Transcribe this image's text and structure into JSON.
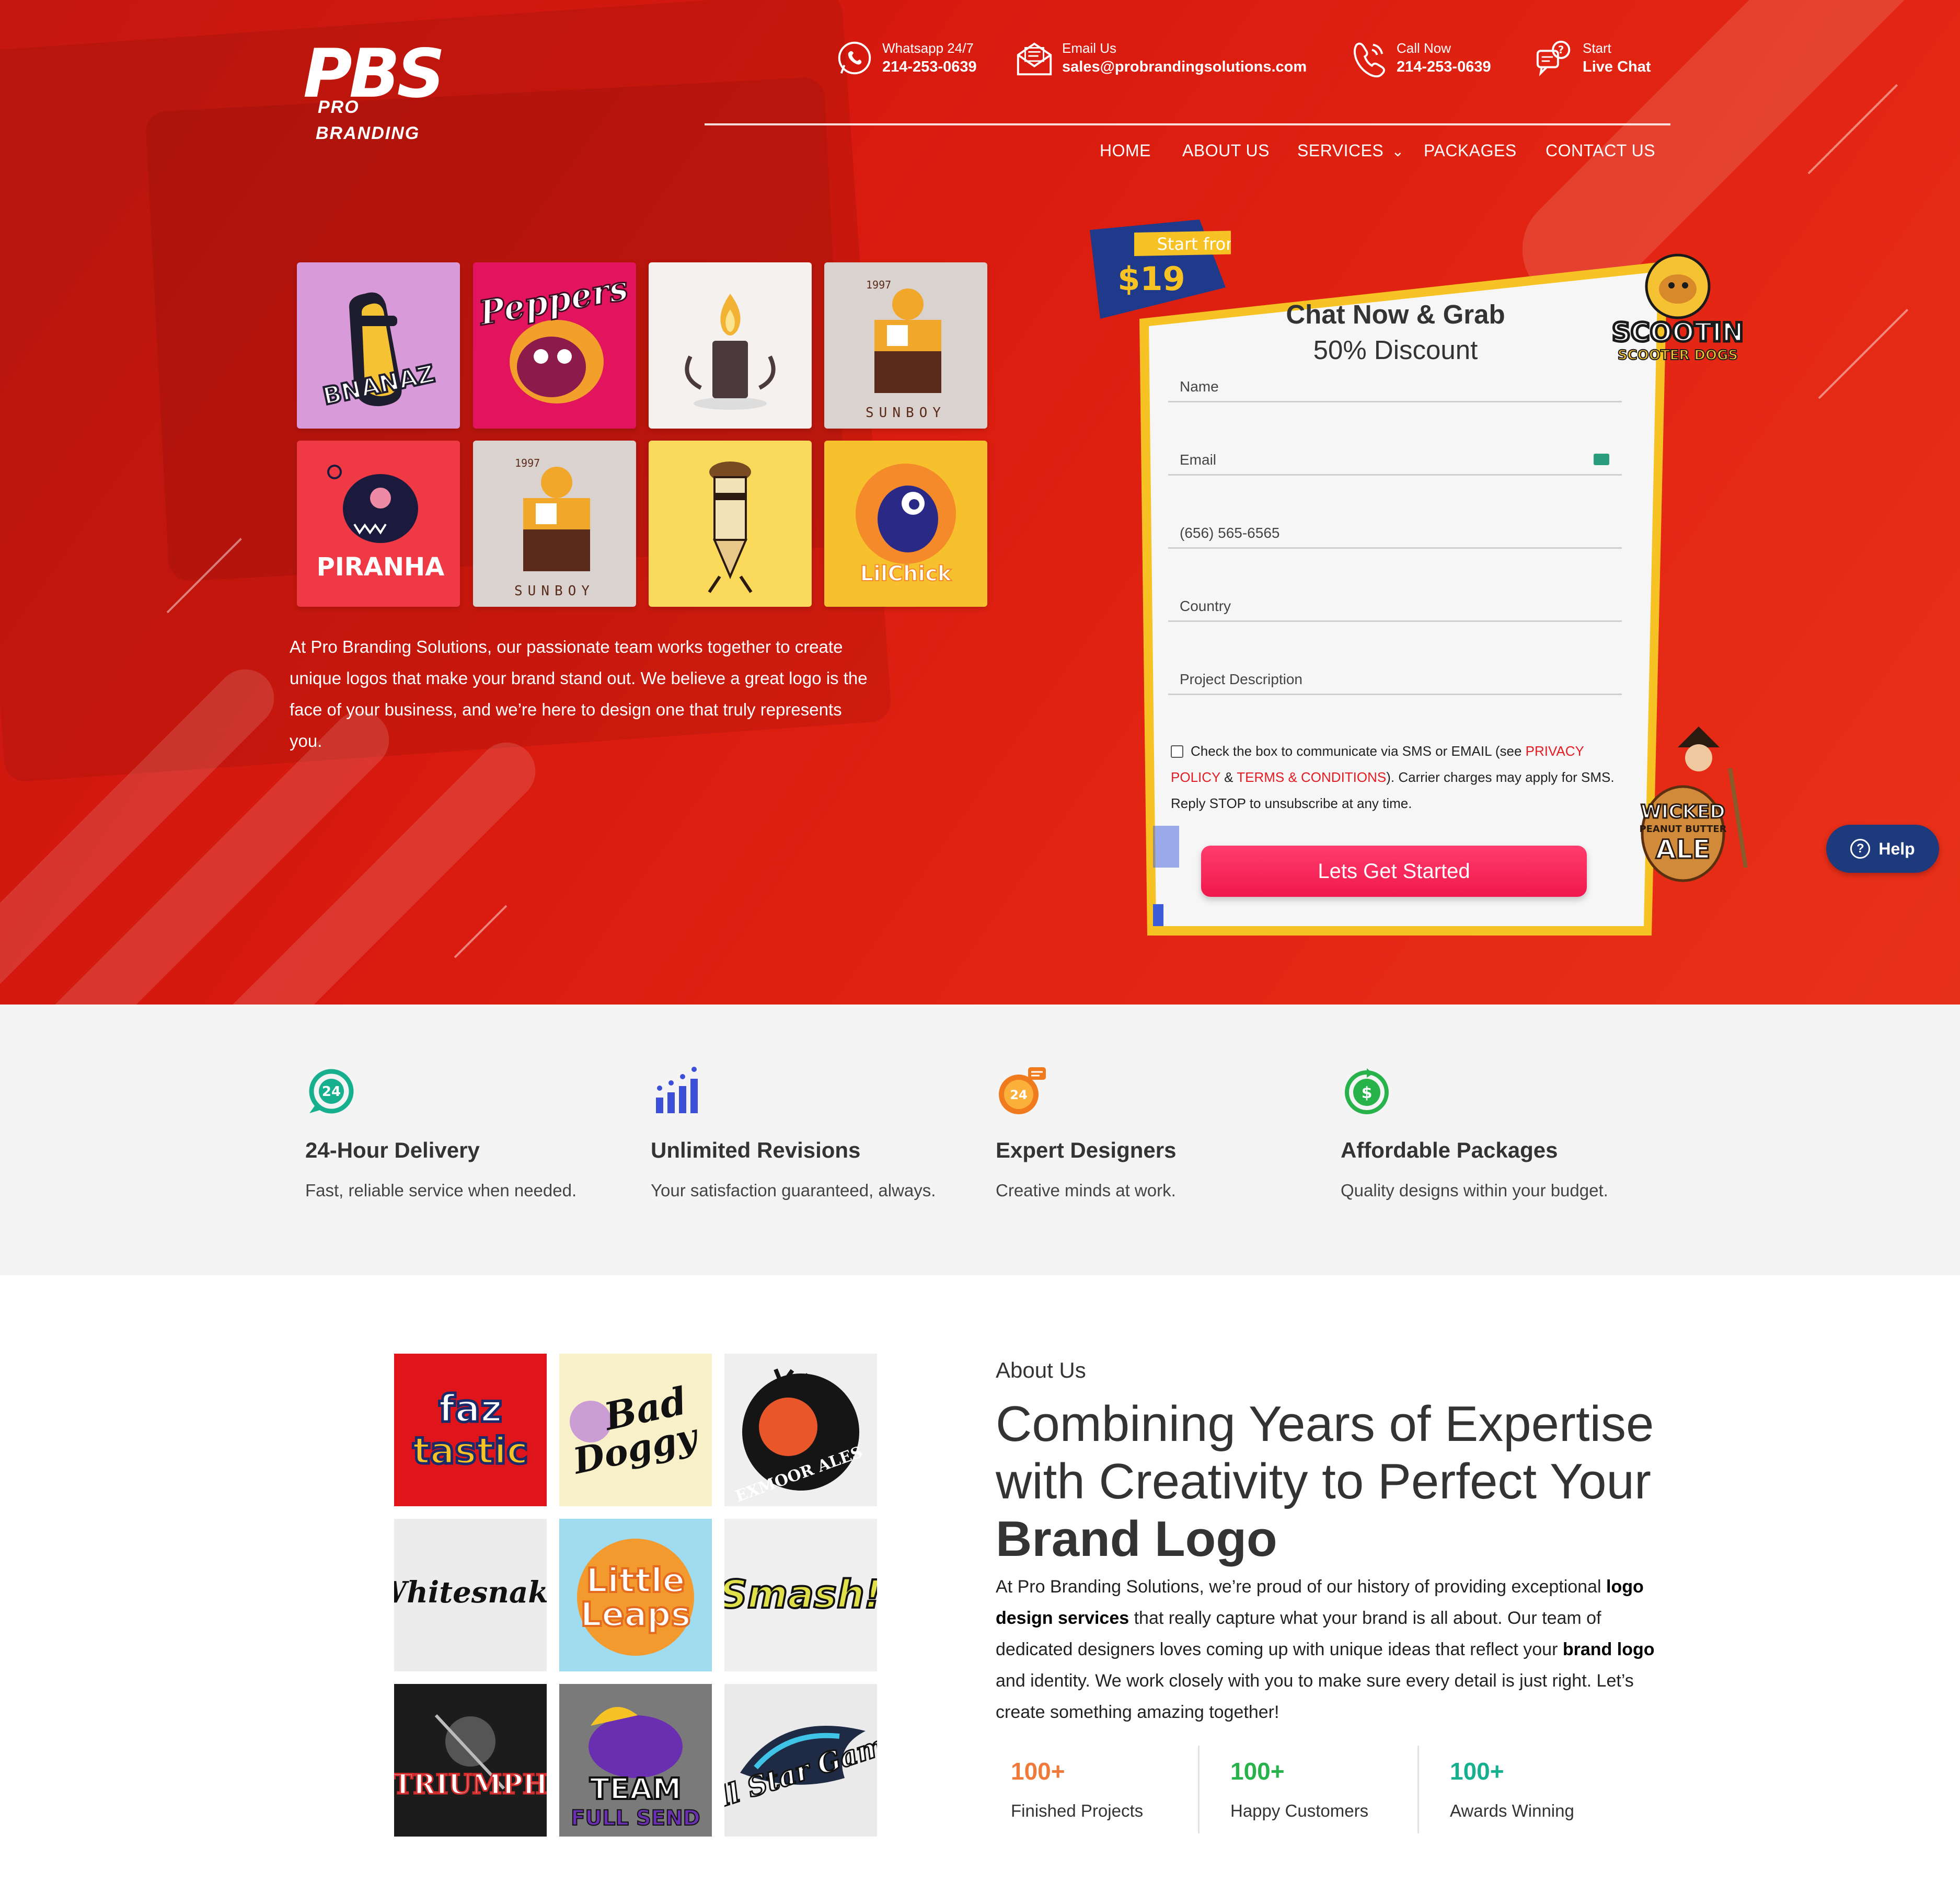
{
  "brand": {
    "logo_text": "PBS",
    "logo_sub1": "PRO",
    "logo_sub2": "BRANDING"
  },
  "contacts": [
    {
      "label": "Whatsapp 24/7",
      "value": "214-253-0639",
      "icon": "whatsapp-icon"
    },
    {
      "label": "Email Us",
      "value": "sales@probrandingsolutions.com",
      "icon": "email-icon"
    },
    {
      "label": "Call Now",
      "value": "214-253-0639",
      "icon": "phone-icon"
    },
    {
      "label": "Start",
      "value": "Live Chat",
      "icon": "chat-icon"
    }
  ],
  "nav": {
    "home": "HOME",
    "about": "ABOUT US",
    "services": "SERVICES",
    "services_caret": "⌄",
    "packages": "PACKAGES",
    "contact": "CONTACT US"
  },
  "hero": {
    "tiles": [
      "BNANAZ",
      "Peppers",
      "",
      "SUNBOY",
      "PIRANHA",
      "SUNBOY",
      "",
      "LilChick"
    ],
    "tile_years": [
      "1997",
      "1997"
    ],
    "text": "At Pro Branding Solutions, our passionate team works together to create unique logos that make your brand stand out. We believe a great logo is the face of your business, and we’re here to design one that truly represents you."
  },
  "offer": {
    "start_from": "Start from",
    "price": "$19",
    "title_line1": "Chat Now & Grab",
    "title_line2": "50% Discount",
    "sticker1_line1": "SCOOTIN",
    "sticker1_line2": "SCOOTER DOGS",
    "sticker2_line1": "WICKED",
    "sticker2_line2": "PEANUT BUTTER",
    "sticker2_line3": "ALE"
  },
  "form": {
    "name_placeholder": "Name",
    "email_placeholder": "Email",
    "phone_placeholder": "(656) 565-6565",
    "country_placeholder": "Country",
    "project_placeholder": "Project Description",
    "consent_pre": "Check the box to communicate via SMS or EMAIL (see ",
    "privacy": "PRIVACY POLICY",
    "amp": " & ",
    "terms": "TERMS & CONDITIONS",
    "consent_post": "). Carrier charges may apply for SMS. Reply STOP to unsubscribe at any time.",
    "submit": "Lets Get Started"
  },
  "help": {
    "label": "Help",
    "glyph": "?"
  },
  "features": [
    {
      "title": "24-Hour Delivery",
      "desc": "Fast, reliable service when needed.",
      "icon": "clock-24-icon",
      "color": "#16b08f",
      "badge": "24"
    },
    {
      "title": "Unlimited Revisions",
      "desc": "Your satisfaction guaranteed, always.",
      "icon": "bar-chart-icon",
      "color": "#3b4fd8"
    },
    {
      "title": "Expert Designers",
      "desc": "Creative minds at work.",
      "icon": "support-24-icon",
      "color": "#f07a1e",
      "badge": "24"
    },
    {
      "title": "Affordable Packages",
      "desc": "Quality designs within your budget.",
      "icon": "dollar-cycle-icon",
      "color": "#27b34a",
      "badge": "$"
    }
  ],
  "portfolio": [
    "faz tastic",
    "Bad Doggy",
    "EXMOOR ALES",
    "Whitesnake",
    "Little Leaps",
    "Smash!",
    "TRIUMPH",
    "TEAM FULL SEND",
    "All Star Game"
  ],
  "about": {
    "label": "About Us",
    "title_plain": "Combining Years of Expertise with Creativity to Perfect Your ",
    "title_bold": "Brand Logo",
    "body_1": "At Pro Branding Solutions, we’re proud of our history of providing exceptional ",
    "body_b1": "logo design services",
    "body_2": " that really capture what your brand is all about. Our team of dedicated designers loves coming up with unique ideas that reflect your ",
    "body_b2": "brand logo",
    "body_3": " and identity. We work closely with you to make sure every detail is just right. Let’s create something amazing together!"
  },
  "stats": [
    {
      "num": "100+",
      "label": "Finished Projects",
      "color": "#f07a3a"
    },
    {
      "num": "100+",
      "label": "Happy Customers",
      "color": "#27b34a"
    },
    {
      "num": "100+",
      "label": "Awards Winning",
      "color": "#16b08f"
    }
  ],
  "colors": {
    "hero_red": "#d7190f",
    "cta_pink": "#f0174b",
    "help_navy": "#1d3a7c",
    "form_border": "#f7c324",
    "price_navy": "#1f3a8a"
  }
}
